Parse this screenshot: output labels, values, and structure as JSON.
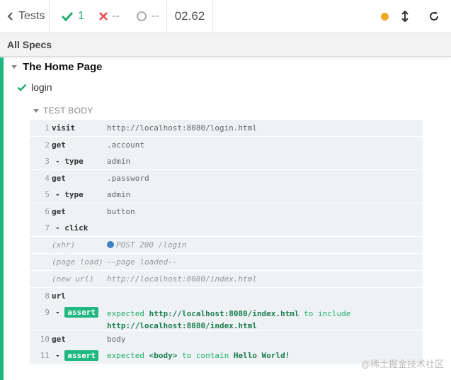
{
  "header": {
    "back_label": "Tests",
    "passed": "1",
    "failed": "--",
    "pending": "--",
    "duration": "02.62"
  },
  "specs_label": "All Specs",
  "suite_title": "The Home Page",
  "test_title": "login",
  "test_body_label": "TEST BODY",
  "commands": [
    {
      "num": "1",
      "name": "visit",
      "message": "http://localhost:8080/login.html"
    },
    {
      "num": "2",
      "name": "get",
      "message": ".account"
    },
    {
      "num": "3",
      "name": "- type",
      "message": "admin"
    },
    {
      "num": "4",
      "name": "get",
      "message": ".password"
    },
    {
      "num": "5",
      "name": "- type",
      "message": "admin"
    },
    {
      "num": "6",
      "name": "get",
      "message": "button"
    },
    {
      "num": "7",
      "name": "- click",
      "message": ""
    },
    {
      "num": "",
      "name": "(xhr)",
      "message": "POST 200 /login"
    },
    {
      "num": "",
      "name": "(page load)",
      "message": "--page loaded--"
    },
    {
      "num": "",
      "name": "(new url)",
      "message": "http://localhost:8080/index.html"
    },
    {
      "num": "8",
      "name": "url",
      "message": ""
    },
    {
      "num": "9",
      "name": "assert",
      "message_parts": [
        "expected",
        "http://localhost:8080/index.html",
        "to include",
        "http://localhost:8080/index.html"
      ]
    },
    {
      "num": "10",
      "name": "get",
      "message": "body"
    },
    {
      "num": "11",
      "name": "assert",
      "message_parts": [
        "expected",
        "<body>",
        "to contain",
        "Hello World!"
      ]
    }
  ],
  "watermark": "@稀土掘金技术社区",
  "colors": {
    "pass": "#1fae6a",
    "fail": "#e94f4f",
    "pending_dot": "#f2a825",
    "xhr": "#3d84c6"
  }
}
